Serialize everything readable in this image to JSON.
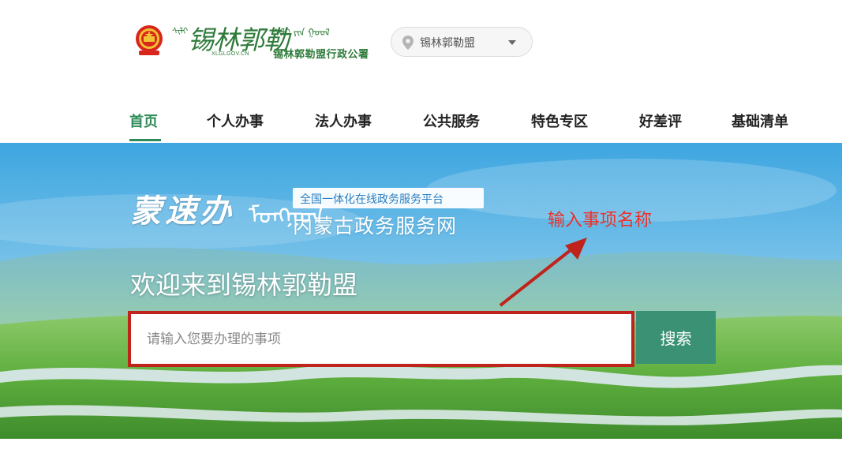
{
  "header": {
    "emblem_icon": "national-emblem-icon",
    "logo": {
      "mongolian_left": "ᠰᠢᠯᠢ",
      "calligraphy": "锡林郭勒",
      "url": "XLGLGOV.CN",
      "mongolian_right": "ᠰᠢᠯᠢ ᠶᠢᠨ ᠭᠣᠣᠯ",
      "office_name": "锡林郭勒盟行政公署"
    },
    "region_selector": {
      "icon": "location-pin-icon",
      "label": "锡林郭勒盟",
      "caret_icon": "caret-down-icon"
    }
  },
  "nav": {
    "items": [
      {
        "label": "首页",
        "active": true
      },
      {
        "label": "个人办事",
        "active": false
      },
      {
        "label": "法人办事",
        "active": false
      },
      {
        "label": "公共服务",
        "active": false
      },
      {
        "label": "特色专区",
        "active": false
      },
      {
        "label": "好差评",
        "active": false
      },
      {
        "label": "基础清单",
        "active": false
      }
    ],
    "accent_color": "#2e8b57"
  },
  "hero": {
    "brand_calligraphy": "蒙速办",
    "brand_mongolian": "ᠮᠣᠩᠭᠣᠯ",
    "platform_tag": "全国一体化在线政务服务平台",
    "platform_name": "内蒙古政务服务网",
    "welcome": "欢迎来到锡林郭勒盟",
    "annotation": "输入事项名称",
    "annotation_color": "#e8322c",
    "search": {
      "placeholder": "请输入您要办理的事项",
      "value": "",
      "button_label": "搜索",
      "button_color": "#3a9173",
      "highlight_border_color": "#c0231b"
    }
  }
}
